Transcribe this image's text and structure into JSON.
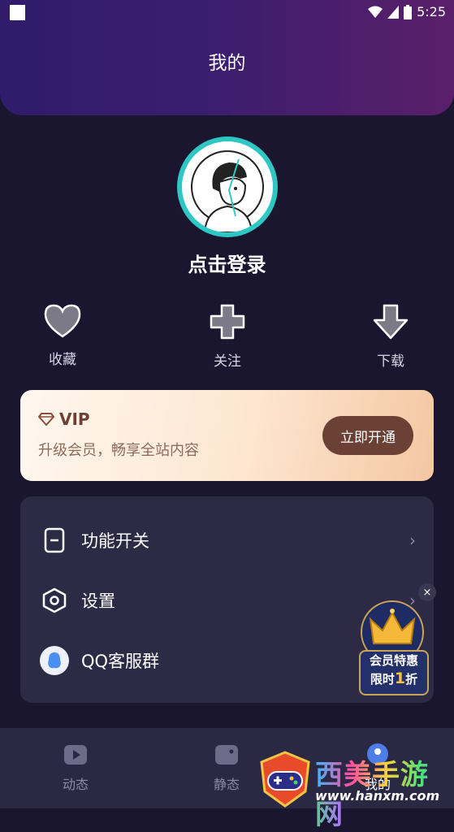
{
  "status_bar": {
    "time": "5:25"
  },
  "header": {
    "title": "我的"
  },
  "profile": {
    "login_label": "点击登录"
  },
  "quick_actions": [
    {
      "label": "收藏",
      "icon": "heart-icon"
    },
    {
      "label": "关注",
      "icon": "plus-icon"
    },
    {
      "label": "下载",
      "icon": "download-icon"
    }
  ],
  "vip": {
    "title": "VIP",
    "subtitle": "升级会员，畅享全站内容",
    "button": "立即开通"
  },
  "menu": [
    {
      "label": "功能开关",
      "icon": "toggle-icon"
    },
    {
      "label": "设置",
      "icon": "settings-hexagon-icon"
    },
    {
      "label": "QQ客服群",
      "icon": "qq-penguin-icon"
    }
  ],
  "promo": {
    "line1": "会员特惠",
    "line2_prefix": "限时",
    "line2_num": "1",
    "line2_suffix": "折",
    "close": "×"
  },
  "tabs": [
    {
      "label": "动态",
      "icon": "play-icon"
    },
    {
      "label": "静态",
      "icon": "image-icon"
    },
    {
      "label": "我的",
      "icon": "profile-icon"
    }
  ],
  "watermark": {
    "text": "西美手游网",
    "url": "www.hanxm.com"
  },
  "colors": {
    "accent": "#2ec7c4",
    "vip_button": "#6b4035",
    "background": "#1a1630",
    "card": "#2d2a45"
  }
}
